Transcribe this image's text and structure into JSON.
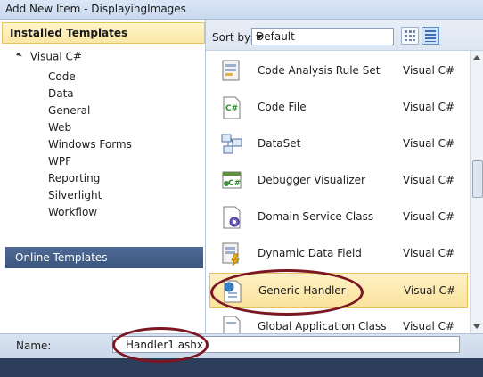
{
  "window": {
    "title": "Add New Item - DisplayingImages"
  },
  "left": {
    "installed_header": "Installed Templates",
    "root": "Visual C#",
    "items": [
      "Code",
      "Data",
      "General",
      "Web",
      "Windows Forms",
      "WPF",
      "Reporting",
      "Silverlight",
      "Workflow"
    ],
    "online_header": "Online Templates"
  },
  "sort": {
    "label": "Sort by:",
    "value": "Default"
  },
  "templates": [
    {
      "name": "Code Analysis Rule Set",
      "lang": "Visual C#",
      "icon": "rule-set-icon"
    },
    {
      "name": "Code File",
      "lang": "Visual C#",
      "icon": "csharp-code-file-icon"
    },
    {
      "name": "DataSet",
      "lang": "Visual C#",
      "icon": "dataset-icon"
    },
    {
      "name": "Debugger Visualizer",
      "lang": "Visual C#",
      "icon": "debugger-visualizer-icon"
    },
    {
      "name": "Domain Service Class",
      "lang": "Visual C#",
      "icon": "domain-service-icon"
    },
    {
      "name": "Dynamic Data Field",
      "lang": "Visual C#",
      "icon": "dynamic-data-field-icon"
    },
    {
      "name": "Generic Handler",
      "lang": "Visual C#",
      "icon": "generic-handler-icon"
    },
    {
      "name": "Global Application Class",
      "lang": "Visual C#",
      "icon": "global-app-class-icon"
    }
  ],
  "name_field": {
    "label": "Name:",
    "value": "Handler1.ashx"
  },
  "colors": {
    "selection": "#fbe39d",
    "annotation": "#7b1622",
    "online_bg": "#3b577f"
  }
}
